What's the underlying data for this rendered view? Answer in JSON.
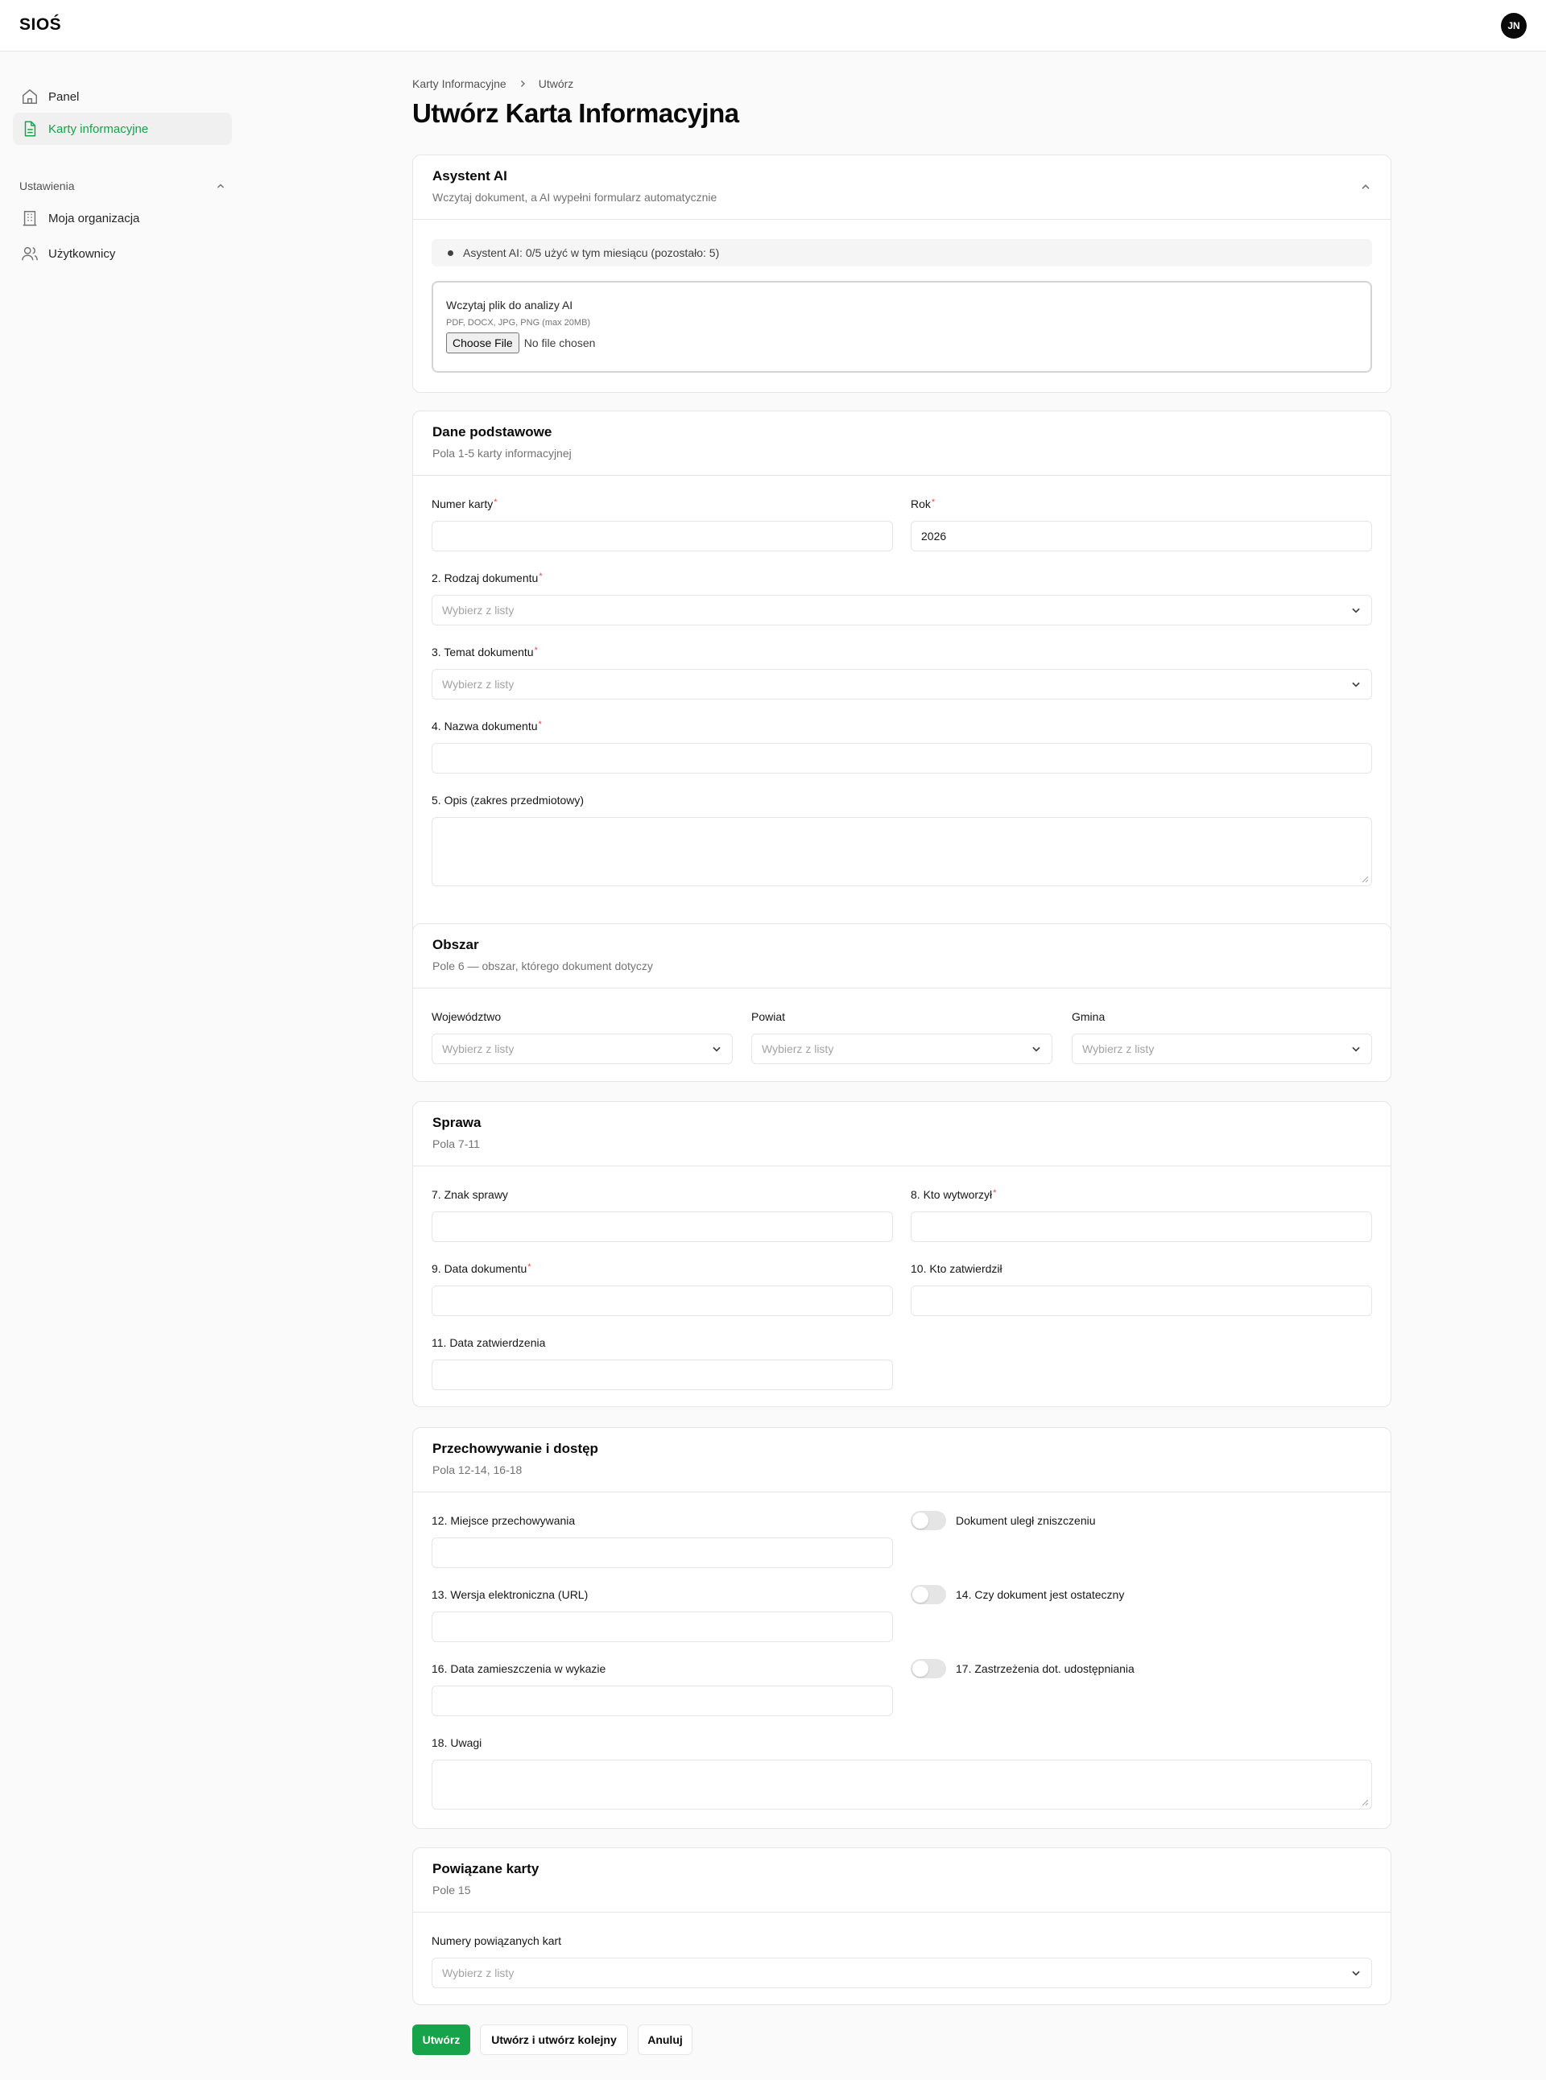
{
  "app": {
    "brand": "SIOŚ",
    "user_initials": "JN"
  },
  "sidebar": {
    "items": [
      {
        "label": "Panel",
        "icon": "home-icon"
      },
      {
        "label": "Karty informacyjne",
        "icon": "document-icon",
        "active": true
      }
    ],
    "group_label": "Ustawienia",
    "settings_items": [
      {
        "label": "Moja organizacja",
        "icon": "building-icon"
      },
      {
        "label": "Użytkownicy",
        "icon": "users-icon"
      }
    ]
  },
  "breadcrumb": {
    "parent": "Karty Informacyjne",
    "current": "Utwórz"
  },
  "page": {
    "title": "Utwórz Karta Informacyjna"
  },
  "ai": {
    "title": "Asystent AI",
    "subtitle": "Wczytaj dokument, a AI wypełni formularz automatycznie",
    "usage": "Asystent AI: 0/5 użyć w tym miesiącu (pozostało: 5)",
    "upload_title": "Wczytaj plik do analizy AI",
    "upload_hint": "PDF, DOCX, JPG, PNG (max 20MB)",
    "choose_label": "Choose File",
    "no_file": "No file chosen"
  },
  "basic": {
    "title": "Dane podstawowe",
    "subtitle": "Pola 1-5 karty informacyjnej",
    "card_number_label": "Numer karty",
    "year_label": "Rok",
    "year_value": "2026",
    "doc_type_label": "2. Rodzaj dokumentu",
    "doc_topic_label": "3. Temat dokumentu",
    "doc_name_label": "4. Nazwa dokumentu",
    "description_label": "5. Opis (zakres przedmiotowy)",
    "select_placeholder": "Wybierz z listy"
  },
  "area": {
    "title": "Obszar",
    "subtitle": "Pole 6 — obszar, którego dokument dotyczy",
    "voivodeship_label": "Województwo",
    "county_label": "Powiat",
    "commune_label": "Gmina",
    "select_placeholder": "Wybierz z listy"
  },
  "case": {
    "title": "Sprawa",
    "subtitle": "Pola 7-11",
    "case_sign_label": "7. Znak sprawy",
    "created_by_label": "8. Kto wytworzył",
    "doc_date_label": "9. Data dokumentu",
    "approved_by_label": "10. Kto zatwierdził",
    "approval_date_label": "11. Data zatwierdzenia"
  },
  "storage": {
    "title": "Przechowywanie i dostęp",
    "subtitle": "Pola 12-14, 16-18",
    "location_label": "12. Miejsce przechowywania",
    "destroyed_label": "Dokument uległ zniszczeniu",
    "url_label": "13. Wersja elektroniczna (URL)",
    "final_label": "14. Czy dokument jest ostateczny",
    "listing_date_label": "16. Data zamieszczenia w wykazie",
    "restrictions_label": "17. Zastrzeżenia dot. udostępniania",
    "notes_label": "18. Uwagi"
  },
  "related": {
    "title": "Powiązane karty",
    "subtitle": "Pole 15",
    "numbers_label": "Numery powiązanych kart",
    "select_placeholder": "Wybierz z listy"
  },
  "actions": {
    "create": "Utwórz",
    "create_another": "Utwórz i utwórz kolejny",
    "cancel": "Anuluj"
  },
  "colors": {
    "accent": "#16a34a",
    "required": "#ef4444",
    "border": "#e5e5e5"
  }
}
